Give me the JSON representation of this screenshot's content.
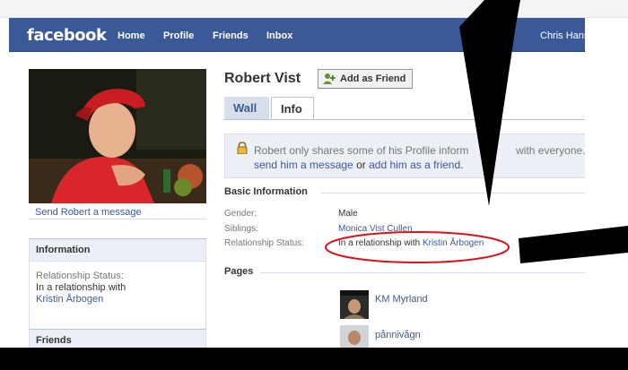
{
  "header": {
    "logo": "facebook",
    "nav": [
      "Home",
      "Profile",
      "Friends",
      "Inbox"
    ],
    "user": "Chris Hans",
    "bg_color": "#3b5998"
  },
  "profile": {
    "name": "Robert Vist",
    "add_friend_label": "Add as Friend",
    "send_message": "Send Robert a message",
    "tabs": [
      "Wall",
      "Info"
    ],
    "active_tab": "Info"
  },
  "privacy": {
    "line1": "Robert only shares some of his Profile inform",
    "line1_tail": "with everyone.",
    "link_message": "send him a message",
    "or": "or",
    "link_add": "add him as a friend",
    "end": "."
  },
  "basic_info": {
    "heading": "Basic Information",
    "rows": [
      {
        "label": "Gender:",
        "value": "Male",
        "link": ""
      },
      {
        "label": "Siblings:",
        "value": "",
        "link": "Monica Vist Cullen"
      },
      {
        "label": "Relationship Status:",
        "value": "In a relationship with ",
        "link": "Kristin Årbogen"
      }
    ]
  },
  "pages": {
    "heading": "Pages",
    "items": [
      "KM Myrland",
      "pånnivågn"
    ]
  },
  "sidebar": {
    "information_heading": "Information",
    "rel_label": "Relationship Status:",
    "rel_value": "In a relationship with",
    "rel_link": "Kristin Årbogen",
    "friends_heading": "Friends"
  },
  "annotation": {
    "ellipse_color": "#d4141a",
    "arrow_color": "#000000"
  }
}
